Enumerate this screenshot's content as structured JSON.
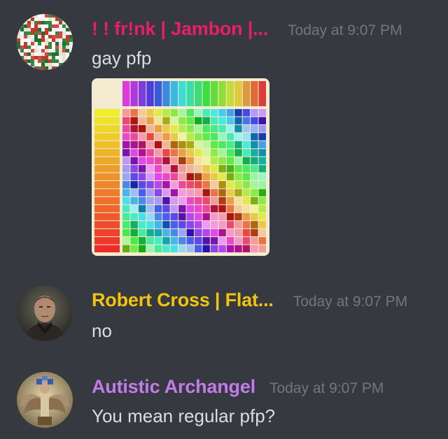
{
  "messages": [
    {
      "username": "! ! fr!nk | Jambon |...",
      "username_color": "#e91e63",
      "timestamp": "Today at 9:07 PM",
      "text": "gay pfp",
      "avatar_icon": "pixel-mosaic-avatar",
      "attachment": {
        "type": "image",
        "icon": "type-chart-rainbow-image",
        "description_hidden": true
      }
    },
    {
      "username": "Robert Cross | Flat...",
      "username_color": "#f1c40f",
      "timestamp": "Today at 9:07 PM",
      "text": "no",
      "avatar_icon": "man-portrait-avatar"
    },
    {
      "username": "Autistic Archangel",
      "username_color": "#c27ce8",
      "timestamp": "Today at 9:07 PM",
      "text": "You mean regular pfp?",
      "avatar_icon": "archangel-avatar"
    }
  ],
  "theme": {
    "background": "#36393f",
    "text_color": "#dcddde",
    "timestamp_color": "#72767d"
  }
}
